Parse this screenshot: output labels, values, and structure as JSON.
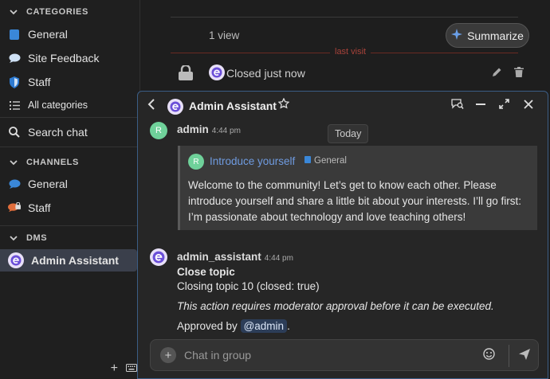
{
  "sidebar": {
    "categories_header": "CATEGORIES",
    "categories": [
      {
        "label": "General",
        "icon": "blue-square-icon",
        "color": "#3a87d8"
      },
      {
        "label": "Site Feedback",
        "icon": "speech-bubble-icon",
        "color": "#cfe1f5"
      },
      {
        "label": "Staff",
        "icon": "shield-icon",
        "color": "#2d7ad1"
      },
      {
        "label": "All categories",
        "icon": "list-icon"
      }
    ],
    "search_chat": "Search chat",
    "channels_header": "CHANNELS",
    "channels": [
      {
        "label": "General",
        "icon": "chat-bubble-icon",
        "color": "#3a87d8"
      },
      {
        "label": "Staff",
        "icon": "chat-bubble-lock-icon",
        "color": "#e06d3b"
      }
    ],
    "dms_header": "DMS",
    "dms": [
      {
        "label": "Admin Assistant",
        "icon": "admin-assistant-avatar"
      }
    ]
  },
  "topic": {
    "views": "1 view",
    "summarize": "Summarize",
    "last_visit": "last visit",
    "closed_text": "Closed just now"
  },
  "chat": {
    "title": "Admin Assistant",
    "today": "Today",
    "messages": [
      {
        "avatar": "R",
        "username": "admin",
        "time": "4:44 pm",
        "quote": {
          "avatar": "R",
          "link": "Introduce yourself",
          "category": "General",
          "body": "Welcome to the community! Let’s get to know each other. Please introduce yourself and share a little bit about your interests. I’ll go first: I’m passionate about technology and love teaching others!"
        }
      },
      {
        "username": "admin_assistant",
        "time": "4:44 pm",
        "action_title": "Close topic",
        "action_detail": "Closing topic 10 (closed: true)",
        "note": "This action requires moderator approval before it can be executed.",
        "approved_prefix": "Approved by",
        "approved_by": "@admin",
        "approved_suffix": "."
      }
    ],
    "composer_placeholder": "Chat in group"
  }
}
